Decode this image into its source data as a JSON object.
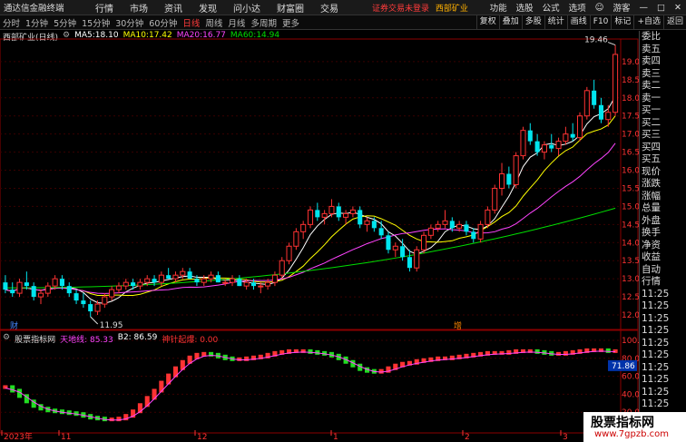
{
  "app": {
    "name": "通达信金融终端"
  },
  "menu": [
    "行情",
    "市场",
    "资讯",
    "发现",
    "问小达",
    "财富圈",
    "交易"
  ],
  "notice": {
    "text": "证券交易未登录",
    "stock": "西部矿业"
  },
  "sysmenu": [
    "功能",
    "选股",
    "公式",
    "选项",
    "游客"
  ],
  "periods": [
    "分时",
    "1分钟",
    "5分钟",
    "15分钟",
    "30分钟",
    "60分钟",
    "日线",
    "周线",
    "月线",
    "多周期",
    "更多"
  ],
  "active_period": "日线",
  "tools": [
    "复权",
    "叠加",
    "多股",
    "统计",
    "画线",
    "F10",
    "标记",
    "+自选",
    "返回"
  ],
  "chart_title": "西部矿业(日线)",
  "ma_legend": [
    {
      "name": "MA5:",
      "value": "18.10",
      "color": "#ffffff"
    },
    {
      "name": "MA10:",
      "value": "17.42",
      "color": "#ffff00"
    },
    {
      "name": "MA20:",
      "value": "16.77",
      "color": "#ff44ff"
    },
    {
      "name": "MA60:",
      "value": "14.94",
      "color": "#00dd00"
    }
  ],
  "indicator_legend": [
    {
      "text": "股票指标网",
      "color": "#dddddd"
    },
    {
      "text": "天地线: 85.33",
      "color": "#ff44ff"
    },
    {
      "text": "B2: 86.59",
      "color": "#ffffff"
    },
    {
      "text": "神针起爆: 0.00",
      "color": "#ff3333"
    }
  ],
  "annotations": {
    "high": "19.46",
    "low": "11.95",
    "mark1": "财",
    "mark2": "增"
  },
  "price_axis": [
    "19.00",
    "18.50",
    "18.00",
    "17.50",
    "17.00",
    "16.50",
    "16.00",
    "15.50",
    "15.00",
    "14.50",
    "14.00",
    "13.50",
    "13.00",
    "12.50",
    "12.00"
  ],
  "indicator_axis": [
    "100.00",
    "80.00",
    "60.00",
    "40.00",
    "20.00"
  ],
  "indicator_current": "71.86",
  "date_axis": [
    "2023年",
    "11",
    "12",
    "1",
    "2",
    "3"
  ],
  "right_panel": [
    "委比",
    "卖五",
    "卖四",
    "卖三",
    "卖二",
    "卖一",
    "买一",
    "买二",
    "买三",
    "买四",
    "买五",
    "现价",
    "涨跌",
    "涨幅",
    "总量",
    "外盘",
    "换手",
    "净资",
    "收益",
    "自动",
    "行情",
    "11:25",
    "11:25",
    "11:25",
    "11:25",
    "11:25",
    "11:25",
    "11:25",
    "11:25",
    "11:25",
    "11:25",
    "11:25",
    "11:25"
  ],
  "watermark": {
    "title": "股票指标网",
    "url": "www.7gpzb.com"
  },
  "colors": {
    "up": "#ff3333",
    "down": "#00e5ee",
    "ma5": "#ffffff",
    "ma10": "#ffff00",
    "ma20": "#ff44ff",
    "ma60": "#00dd00"
  },
  "chart_data": [
    {
      "type": "candlestick",
      "title": "西部矿业(日线)",
      "ylim": [
        11.8,
        19.6
      ],
      "ohlc": [
        [
          12.9,
          13.1,
          12.6,
          12.7
        ],
        [
          12.7,
          12.9,
          12.5,
          12.6
        ],
        [
          12.6,
          13.0,
          12.5,
          12.9
        ],
        [
          12.9,
          13.2,
          12.7,
          12.8
        ],
        [
          12.8,
          12.9,
          12.4,
          12.5
        ],
        [
          12.5,
          12.7,
          12.3,
          12.6
        ],
        [
          12.6,
          12.9,
          12.5,
          12.8
        ],
        [
          12.8,
          13.1,
          12.7,
          13.0
        ],
        [
          13.0,
          13.1,
          12.7,
          12.8
        ],
        [
          12.8,
          12.9,
          12.5,
          12.6
        ],
        [
          12.6,
          12.7,
          12.3,
          12.4
        ],
        [
          12.4,
          12.6,
          12.2,
          12.3
        ],
        [
          12.3,
          12.4,
          11.95,
          12.1
        ],
        [
          12.1,
          12.4,
          12.0,
          12.3
        ],
        [
          12.3,
          12.6,
          12.2,
          12.5
        ],
        [
          12.5,
          12.8,
          12.4,
          12.7
        ],
        [
          12.7,
          12.9,
          12.6,
          12.8
        ],
        [
          12.8,
          13.0,
          12.7,
          12.9
        ],
        [
          12.9,
          13.0,
          12.7,
          12.8
        ],
        [
          12.8,
          13.0,
          12.7,
          12.9
        ],
        [
          12.9,
          13.1,
          12.8,
          13.0
        ],
        [
          13.0,
          13.1,
          12.8,
          12.9
        ],
        [
          12.9,
          13.2,
          12.8,
          13.1
        ],
        [
          13.1,
          13.3,
          13.0,
          13.0
        ],
        [
          13.0,
          13.2,
          12.9,
          13.1
        ],
        [
          13.1,
          13.3,
          13.0,
          13.2
        ],
        [
          13.2,
          13.3,
          13.0,
          13.0
        ],
        [
          13.0,
          13.1,
          12.8,
          12.9
        ],
        [
          12.9,
          13.1,
          12.8,
          13.0
        ],
        [
          13.0,
          13.2,
          12.9,
          13.1
        ],
        [
          13.1,
          13.2,
          12.9,
          12.9
        ],
        [
          12.9,
          13.0,
          12.8,
          12.9
        ],
        [
          12.9,
          13.1,
          12.8,
          13.0
        ],
        [
          13.0,
          13.1,
          12.8,
          12.8
        ],
        [
          12.8,
          13.0,
          12.7,
          12.9
        ],
        [
          12.9,
          13.0,
          12.7,
          12.8
        ],
        [
          12.8,
          12.9,
          12.6,
          12.8
        ],
        [
          12.8,
          13.0,
          12.7,
          12.9
        ],
        [
          12.9,
          13.2,
          12.8,
          13.1
        ],
        [
          13.1,
          13.6,
          13.0,
          13.5
        ],
        [
          13.5,
          14.0,
          13.4,
          13.9
        ],
        [
          13.9,
          14.4,
          13.8,
          14.3
        ],
        [
          14.3,
          14.6,
          14.1,
          14.5
        ],
        [
          14.5,
          15.0,
          14.4,
          14.9
        ],
        [
          14.9,
          15.1,
          14.6,
          14.7
        ],
        [
          14.7,
          14.9,
          14.5,
          14.8
        ],
        [
          14.8,
          15.2,
          14.7,
          15.0
        ],
        [
          15.0,
          15.1,
          14.6,
          14.7
        ],
        [
          14.7,
          14.9,
          14.5,
          14.8
        ],
        [
          14.8,
          15.0,
          14.7,
          14.9
        ],
        [
          14.9,
          15.0,
          14.4,
          14.5
        ],
        [
          14.5,
          14.7,
          14.3,
          14.6
        ],
        [
          14.6,
          14.7,
          14.3,
          14.4
        ],
        [
          14.4,
          14.6,
          14.1,
          14.2
        ],
        [
          14.2,
          14.3,
          13.7,
          13.8
        ],
        [
          13.8,
          14.0,
          13.6,
          13.9
        ],
        [
          13.9,
          14.1,
          13.5,
          13.6
        ],
        [
          13.6,
          13.8,
          13.2,
          13.3
        ],
        [
          13.3,
          13.9,
          13.2,
          13.8
        ],
        [
          13.8,
          14.3,
          13.7,
          14.2
        ],
        [
          14.2,
          14.5,
          14.1,
          14.4
        ],
        [
          14.4,
          14.6,
          14.3,
          14.5
        ],
        [
          14.5,
          14.9,
          14.4,
          14.6
        ],
        [
          14.6,
          14.7,
          14.3,
          14.4
        ],
        [
          14.4,
          14.6,
          14.3,
          14.5
        ],
        [
          14.5,
          14.6,
          14.2,
          14.3
        ],
        [
          14.3,
          14.4,
          14.0,
          14.1
        ],
        [
          14.1,
          14.6,
          14.0,
          14.5
        ],
        [
          14.5,
          15.0,
          14.4,
          14.9
        ],
        [
          14.9,
          15.6,
          14.8,
          15.5
        ],
        [
          15.5,
          16.2,
          15.3,
          15.9
        ],
        [
          15.9,
          16.1,
          15.5,
          15.6
        ],
        [
          15.6,
          16.5,
          15.5,
          16.4
        ],
        [
          16.4,
          17.2,
          16.3,
          17.1
        ],
        [
          17.1,
          17.3,
          16.7,
          16.8
        ],
        [
          16.8,
          17.0,
          16.4,
          16.5
        ],
        [
          16.5,
          16.8,
          16.3,
          16.7
        ],
        [
          16.7,
          17.0,
          16.5,
          16.6
        ],
        [
          16.6,
          16.9,
          16.4,
          16.8
        ],
        [
          16.8,
          17.2,
          16.7,
          17.0
        ],
        [
          17.0,
          17.3,
          16.8,
          16.9
        ],
        [
          16.9,
          17.6,
          16.8,
          17.5
        ],
        [
          17.5,
          18.3,
          17.4,
          18.2
        ],
        [
          18.2,
          18.5,
          17.7,
          17.8
        ],
        [
          17.8,
          18.0,
          17.3,
          17.4
        ],
        [
          17.4,
          17.8,
          17.2,
          17.6
        ],
        [
          17.6,
          19.46,
          17.5,
          19.2
        ]
      ],
      "low_label": "11.95",
      "high_label": "19.46"
    },
    {
      "type": "bar",
      "name": "indicator",
      "ylim": [
        0,
        100
      ],
      "values": [
        48,
        44,
        38,
        32,
        27,
        24,
        22,
        21,
        20,
        19,
        18,
        16,
        14,
        13,
        12,
        12,
        13,
        16,
        21,
        28,
        36,
        44,
        53,
        61,
        69,
        76,
        81,
        84,
        85,
        84,
        82,
        80,
        79,
        79,
        80,
        81,
        82,
        84,
        86,
        87,
        88,
        88,
        88,
        87,
        86,
        85,
        83,
        80,
        76,
        72,
        68,
        66,
        65,
        66,
        69,
        72,
        74,
        75,
        77,
        78,
        79,
        80,
        80,
        81,
        82,
        83,
        84,
        85,
        86,
        86,
        86,
        87,
        88,
        88,
        88,
        87,
        86,
        85,
        85,
        86,
        87,
        88,
        89,
        89,
        89,
        88,
        88
      ]
    }
  ]
}
